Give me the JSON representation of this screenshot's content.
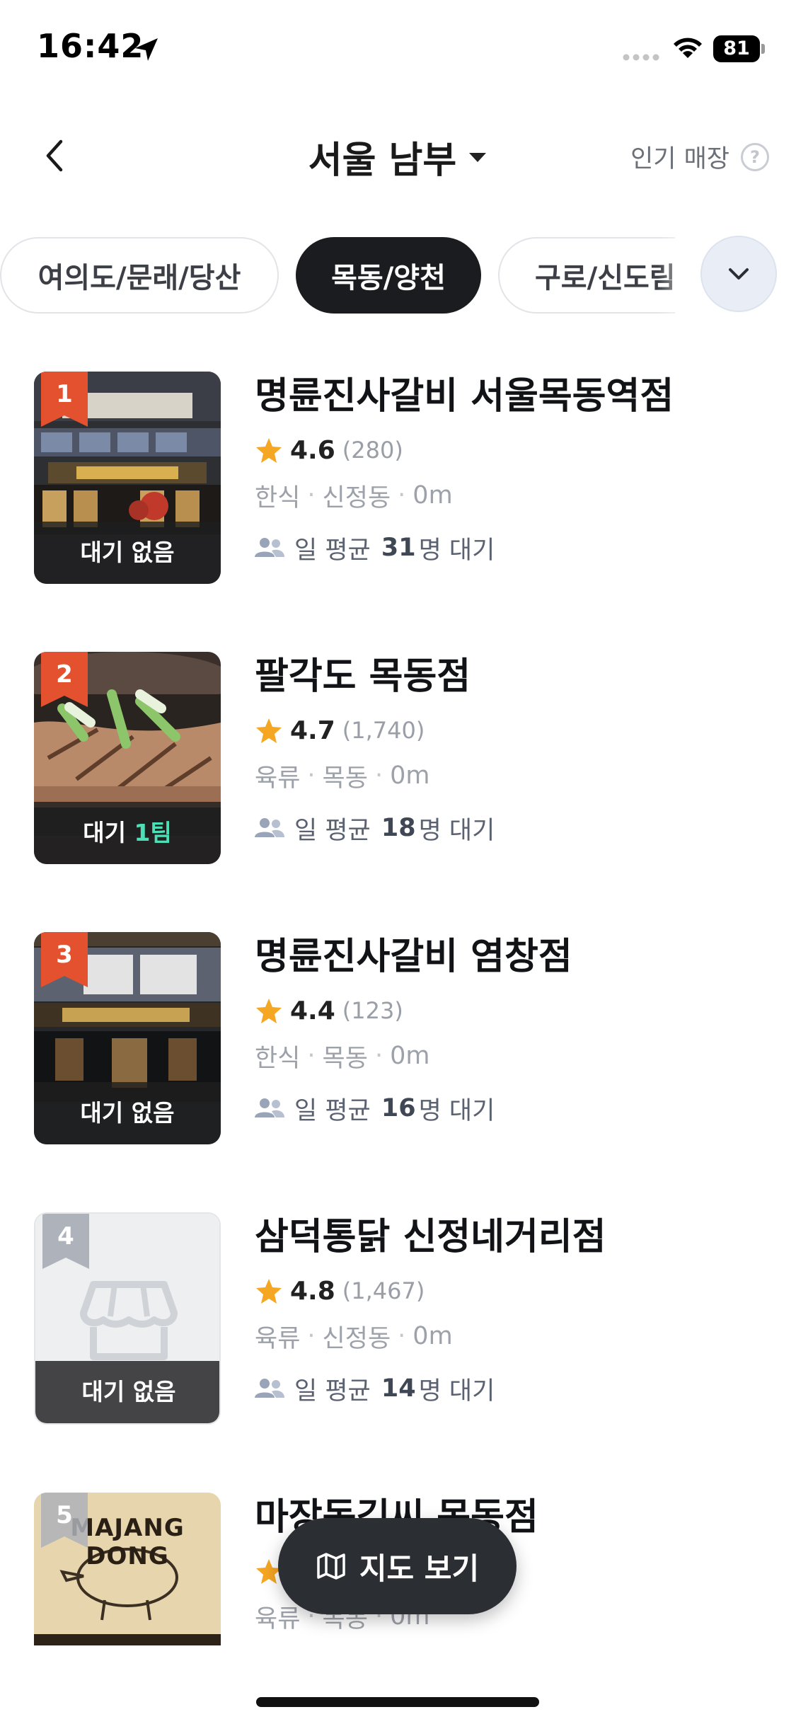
{
  "status_bar": {
    "time": "16:42",
    "battery": "81"
  },
  "header": {
    "title": "서울 남부",
    "popular_label": "인기 매장",
    "help_icon_text": "?"
  },
  "chips": [
    {
      "label": "여의도/문래/당산",
      "active": false
    },
    {
      "label": "목동/양천",
      "active": true
    },
    {
      "label": "구로/신도림",
      "active": false
    }
  ],
  "stores": [
    {
      "rank": "1",
      "name": "명륜진사갈비 서울목동역점",
      "rating": "4.6",
      "reviews": "(280)",
      "category": "한식",
      "area": "신정동",
      "distance": "0m",
      "wait_status": "대기 없음",
      "wait_prefix": "일 평균",
      "wait_count": "31",
      "wait_suffix": "명 대기"
    },
    {
      "rank": "2",
      "name": "팔각도 목동점",
      "rating": "4.7",
      "reviews": "(1,740)",
      "category": "육류",
      "area": "목동",
      "distance": "0m",
      "wait_status_prefix": "대기",
      "wait_status_highlight": "1팀",
      "wait_prefix": "일 평균",
      "wait_count": "18",
      "wait_suffix": "명 대기"
    },
    {
      "rank": "3",
      "name": "명륜진사갈비 염창점",
      "rating": "4.4",
      "reviews": "(123)",
      "category": "한식",
      "area": "목동",
      "distance": "0m",
      "wait_status": "대기 없음",
      "wait_prefix": "일 평균",
      "wait_count": "16",
      "wait_suffix": "명 대기"
    },
    {
      "rank": "4",
      "name": "삼덕통닭 신정네거리점",
      "rating": "4.8",
      "reviews": "(1,467)",
      "category": "육류",
      "area": "신정동",
      "distance": "0m",
      "wait_status": "대기 없음",
      "wait_prefix": "일 평균",
      "wait_count": "14",
      "wait_suffix": "명 대기"
    },
    {
      "rank": "5",
      "name": "마장동김씨 목동점",
      "category": "육류",
      "area": "목동",
      "distance": "0m",
      "thumb_sign": "MAJANG DONG"
    }
  ],
  "map_button": {
    "label": "지도 보기"
  },
  "colors": {
    "accent_red": "#e4512f",
    "dark": "#1b1c1f",
    "wait_highlight": "#4de0b6",
    "star": "#f5a623"
  }
}
